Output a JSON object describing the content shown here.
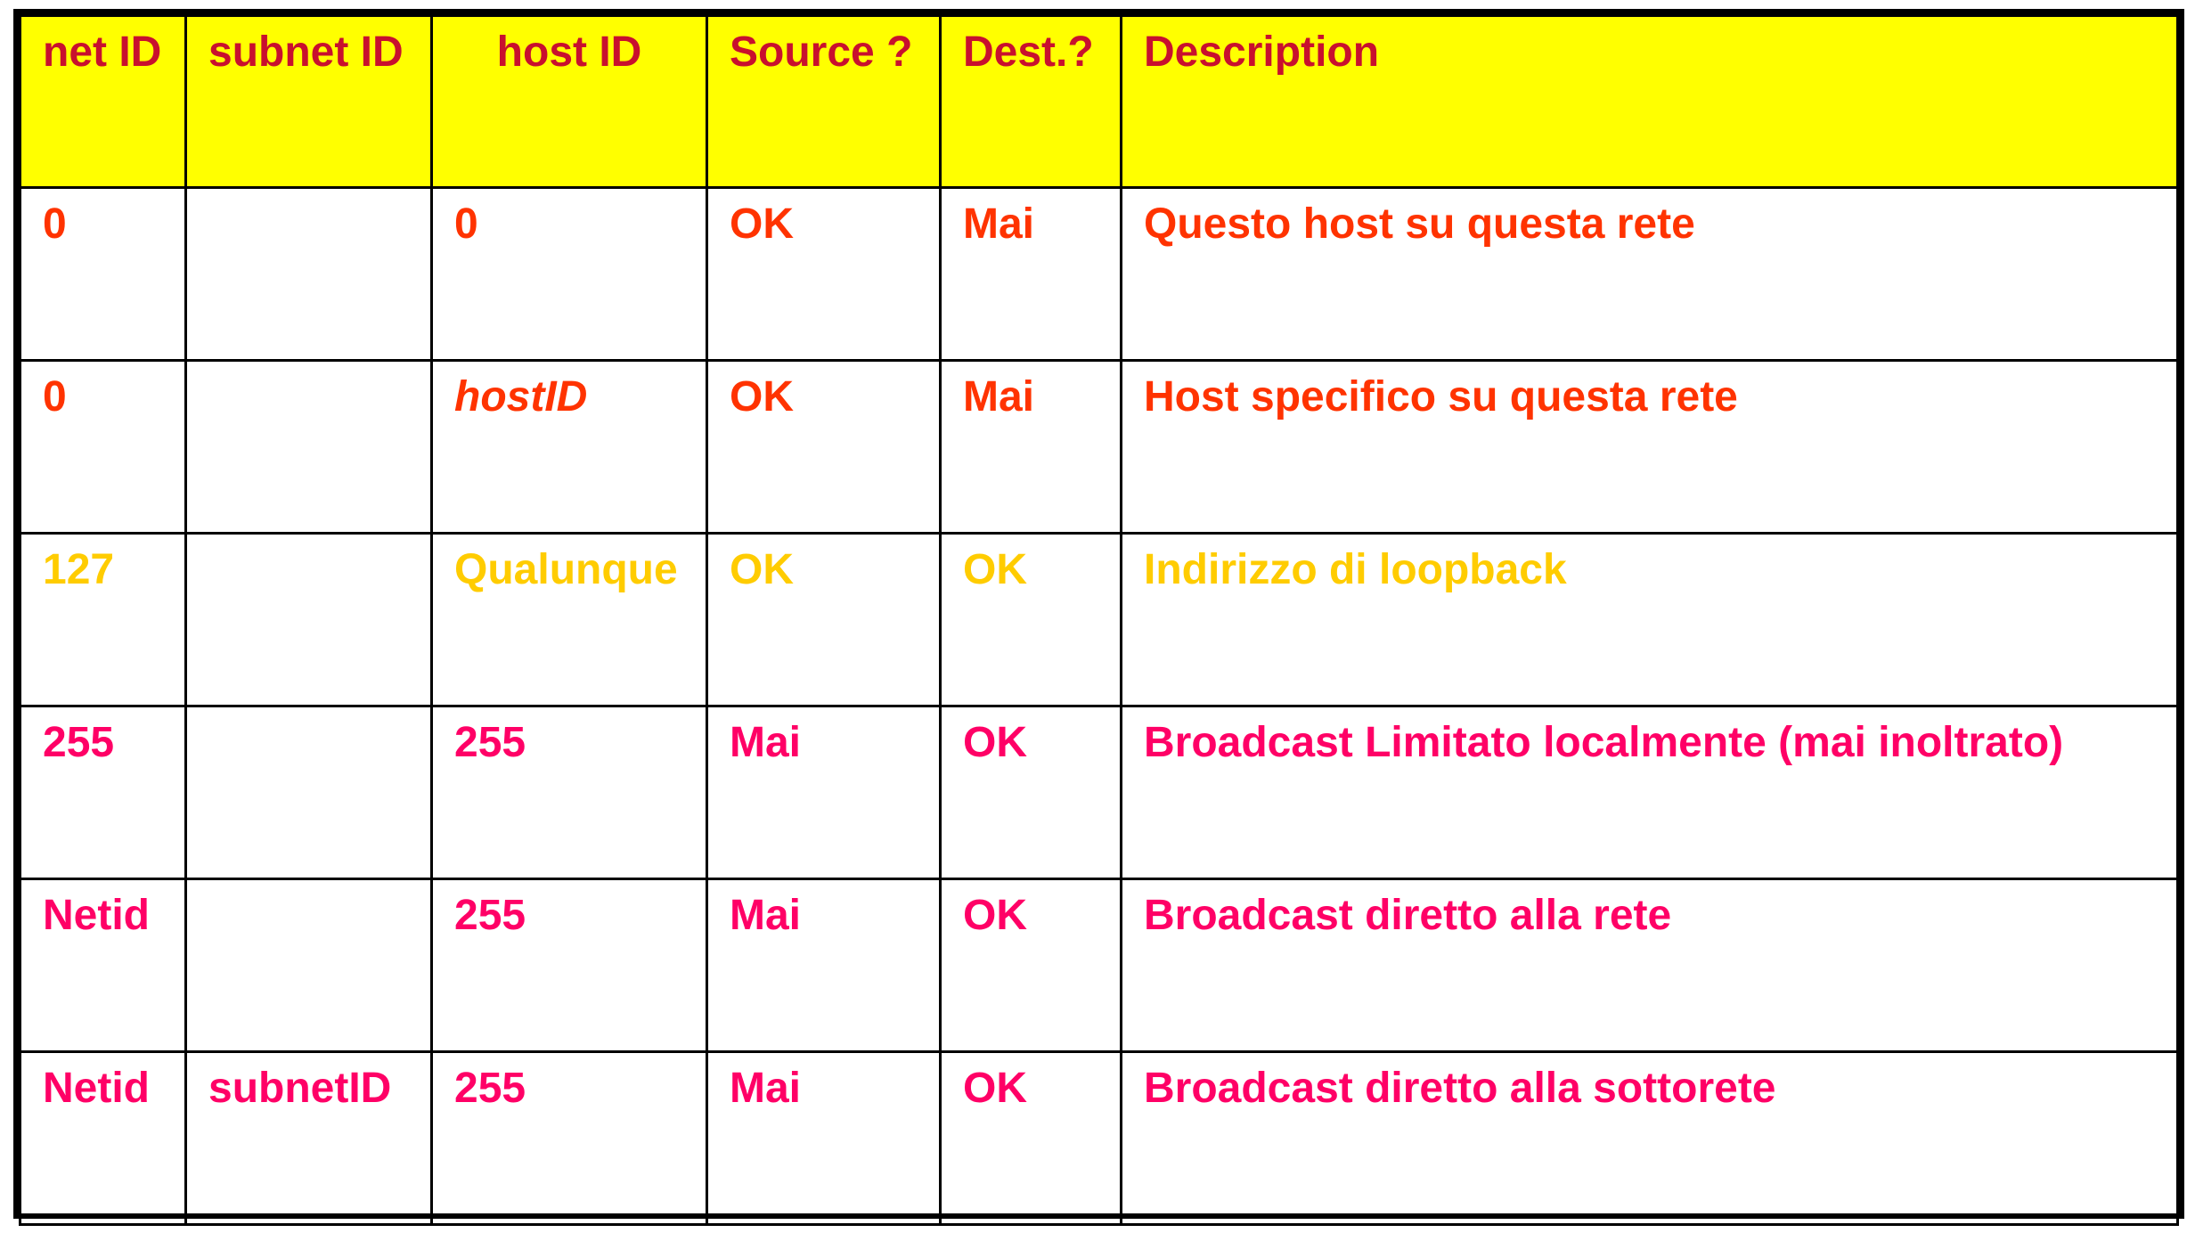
{
  "colors": {
    "header_bg": "#ffff00",
    "header_text": "#c8102e",
    "red": "#ff3300",
    "yellow": "#ffcc00",
    "pink": "#ff0066",
    "border": "#000000"
  },
  "table": {
    "headers": [
      "net ID",
      "subnet ID",
      "host ID",
      "Source ?",
      "Dest.?",
      "Description"
    ],
    "rows": [
      {
        "tone": "red",
        "cells": [
          "0",
          "",
          "0",
          "OK",
          "Mai",
          "Questo host su questa rete"
        ]
      },
      {
        "tone": "red",
        "cells": [
          "0",
          "",
          "hostID",
          "OK",
          "Mai",
          "Host specifico su questa rete"
        ]
      },
      {
        "tone": "yellow",
        "cells": [
          "127",
          "",
          "Qualunque",
          "OK",
          "OK",
          "Indirizzo di loopback"
        ]
      },
      {
        "tone": "pink",
        "cells": [
          "255",
          "",
          "255",
          "Mai",
          "OK",
          "Broadcast Limitato localmente (mai inoltrato)"
        ]
      },
      {
        "tone": "pink",
        "cells": [
          "Netid",
          "",
          "255",
          "Mai",
          "OK",
          "Broadcast diretto alla rete"
        ]
      },
      {
        "tone": "pink",
        "cells": [
          "Netid",
          "subnetID",
          "255",
          "Mai",
          "OK",
          "Broadcast diretto alla sottorete"
        ]
      }
    ]
  }
}
